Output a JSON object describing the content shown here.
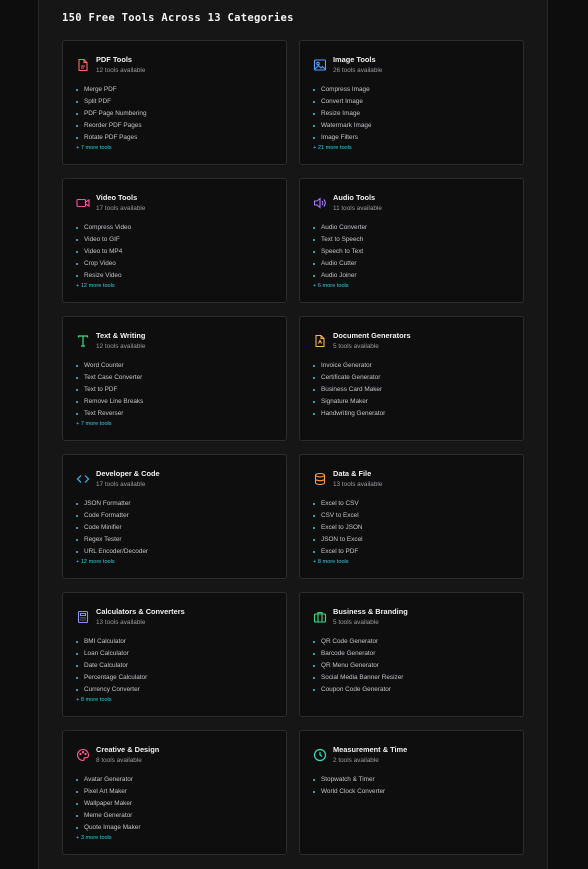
{
  "heading": "150 Free Tools Across 13 Categories",
  "colors": {
    "bullet": "#34d0d8",
    "more_link": "#3fc6dc"
  },
  "categories": [
    {
      "title": "PDF Tools",
      "count": "12 tools available",
      "icon": "pdf-file-icon",
      "icon_color": "#ff6b5e",
      "tools": [
        "Merge PDF",
        "Split PDF",
        "PDF Page Numbering",
        "Reorder PDF Pages",
        "Rotate PDF Pages"
      ],
      "more": "+ 7 more tools"
    },
    {
      "title": "Image Tools",
      "count": "26 tools available",
      "icon": "image-icon",
      "icon_color": "#4ea3ff",
      "tools": [
        "Compress Image",
        "Convert Image",
        "Resize Image",
        "Watermark Image",
        "Image Filters"
      ],
      "more": "+ 21 more tools"
    },
    {
      "title": "Video Tools",
      "count": "17 tools available",
      "icon": "video-camera-icon",
      "icon_color": "#ff4fa3",
      "tools": [
        "Compress Video",
        "Video to GIF",
        "Video to MP4",
        "Crop Video",
        "Resize Video"
      ],
      "more": "+ 12 more tools"
    },
    {
      "title": "Audio Tools",
      "count": "11 tools available",
      "icon": "speaker-icon",
      "icon_color": "#a97bff",
      "tools": [
        "Audio Converter",
        "Text to Speech",
        "Speech to Text",
        "Audio Cutter",
        "Audio Joiner"
      ],
      "more": "+ 6 more tools"
    },
    {
      "title": "Text & Writing",
      "count": "12 tools available",
      "icon": "text-type-icon",
      "icon_color": "#3ddc84",
      "tools": [
        "Word Counter",
        "Text Case Converter",
        "Text to PDF",
        "Remove Line Breaks",
        "Text Reverser"
      ],
      "more": "+ 7 more tools"
    },
    {
      "title": "Document Generators",
      "count": "5 tools available",
      "icon": "document-icon",
      "icon_color": "#ffb347",
      "tools": [
        "Invoice Generator",
        "Certificate Generator",
        "Business Card Maker",
        "Signature Maker",
        "Handwriting Generator"
      ],
      "more": ""
    },
    {
      "title": "Developer & Code",
      "count": "17 tools available",
      "icon": "code-brackets-icon",
      "icon_color": "#3fb5ff",
      "tools": [
        "JSON Formatter",
        "Code Formatter",
        "Code Minifier",
        "Regex Tester",
        "URL Encoder/Decoder"
      ],
      "more": "+ 12 more tools"
    },
    {
      "title": "Data & File",
      "count": "13 tools available",
      "icon": "database-icon",
      "icon_color": "#ff9a3c",
      "tools": [
        "Excel to CSV",
        "CSV to Excel",
        "Excel to JSON",
        "JSON to Excel",
        "Excel to PDF"
      ],
      "more": "+ 8 more tools"
    },
    {
      "title": "Calculators & Converters",
      "count": "13 tools available",
      "icon": "calculator-icon",
      "icon_color": "#8c8cff",
      "tools": [
        "BMI Calculator",
        "Loan Calculator",
        "Date Calculator",
        "Percentage Calculator",
        "Currency Converter"
      ],
      "more": "+ 8 more tools"
    },
    {
      "title": "Business & Branding",
      "count": "5 tools available",
      "icon": "briefcase-icon",
      "icon_color": "#3ddc84",
      "tools": [
        "QR Code Generator",
        "Barcode Generator",
        "QR Menu Generator",
        "Social Media Banner Resizer",
        "Coupon Code Generator"
      ],
      "more": ""
    },
    {
      "title": "Creative & Design",
      "count": "8 tools available",
      "icon": "palette-icon",
      "icon_color": "#ff5c8a",
      "tools": [
        "Avatar Generator",
        "Pixel Art Maker",
        "Wallpaper Maker",
        "Meme Generator",
        "Quote Image Maker"
      ],
      "more": "+ 3 more tools"
    },
    {
      "title": "Measurement & Time",
      "count": "2 tools available",
      "icon": "clock-icon",
      "icon_color": "#2ee0c0",
      "tools": [
        "Stopwatch & Timer",
        "World Clock Converter"
      ],
      "more": ""
    }
  ]
}
